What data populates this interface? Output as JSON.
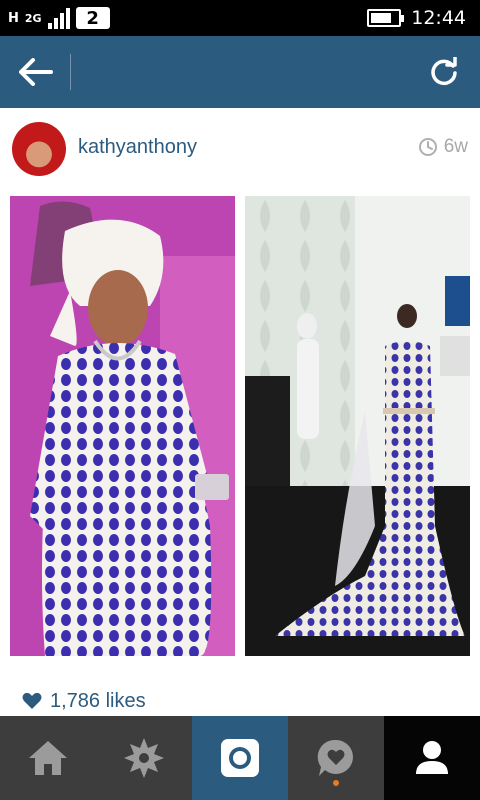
{
  "status_bar": {
    "network_type": "H",
    "network_mode": "2G",
    "sim_slot": "2",
    "time": "12:44",
    "battery_level": 0.75
  },
  "header": {
    "back_icon": "arrow-left-icon",
    "refresh_icon": "refresh-icon"
  },
  "post": {
    "username": "kathyanthony",
    "time_ago": "6w",
    "likes": "1,786 likes"
  },
  "bottom_nav": {
    "items": [
      {
        "icon": "home-icon"
      },
      {
        "icon": "explore-icon"
      },
      {
        "icon": "camera-icon"
      },
      {
        "icon": "news-icon"
      },
      {
        "icon": "profile-icon"
      }
    ]
  },
  "colors": {
    "header_bg": "#2c5b80",
    "nav_bg": "#3d3d3d",
    "accent": "#2c5b80",
    "notification_dot": "#e87c1e"
  }
}
